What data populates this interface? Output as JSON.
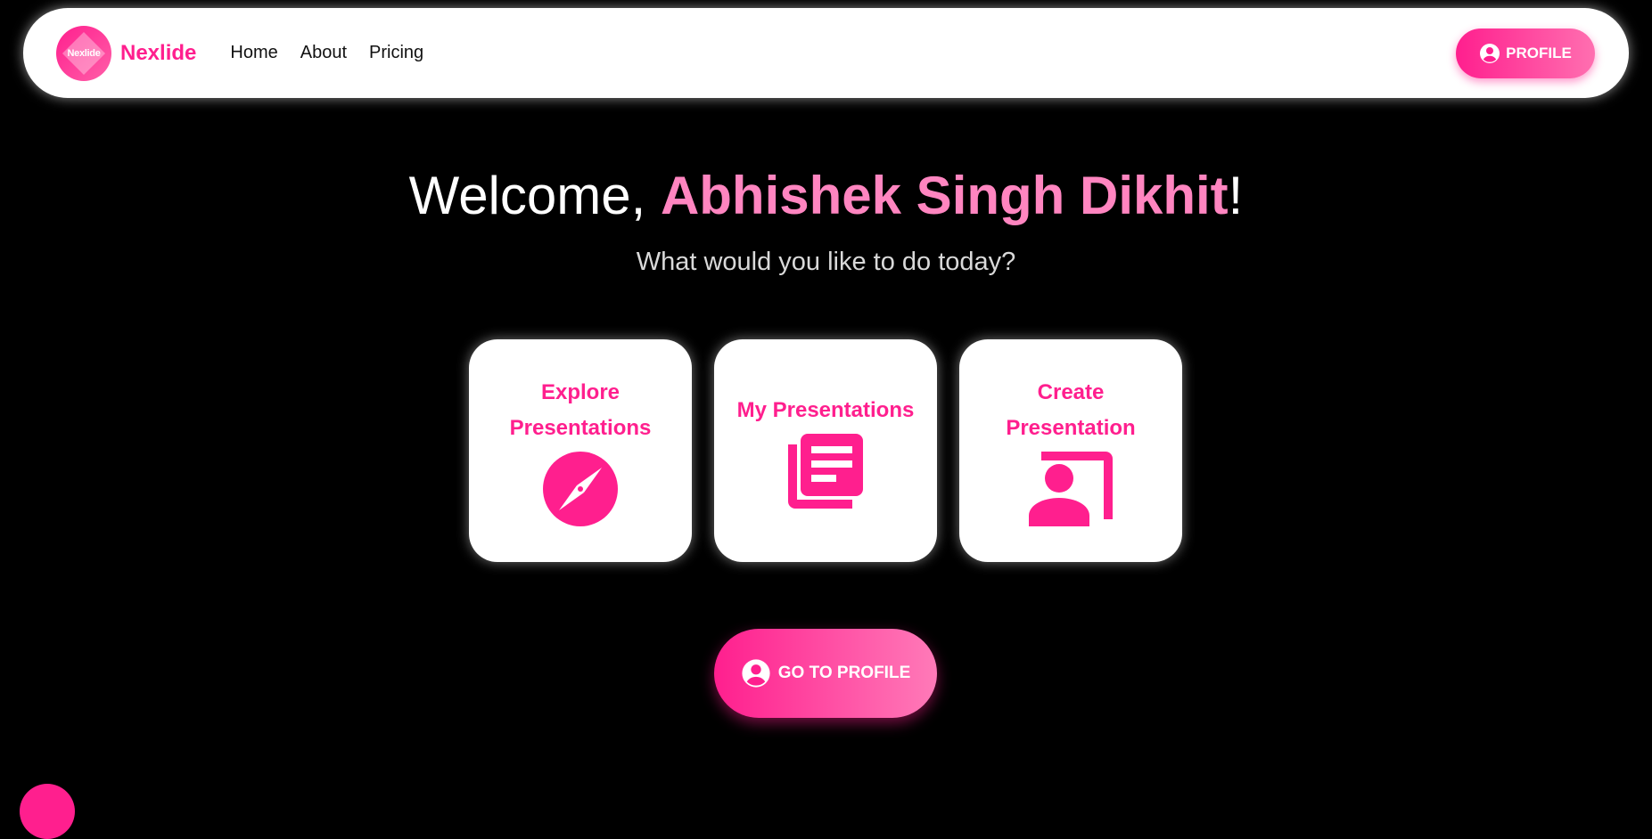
{
  "brand": {
    "logo_text": "Nexlide",
    "name": "Nexlide"
  },
  "nav": {
    "links": [
      {
        "label": "Home"
      },
      {
        "label": "About"
      },
      {
        "label": "Pricing"
      }
    ],
    "profile_button": "PROFILE"
  },
  "hero": {
    "welcome_prefix": "Welcome, ",
    "user_name": "Abhishek Singh Dikhit",
    "welcome_suffix": "!",
    "subtitle": "What would you like to do today?"
  },
  "cards": [
    {
      "title": "Explore Presentations",
      "icon": "compass-icon"
    },
    {
      "title": "My Presentations",
      "icon": "library-books-icon"
    },
    {
      "title": "Create Presentation",
      "icon": "present-to-user-icon"
    }
  ],
  "cta": {
    "label": "GO TO PROFILE",
    "icon": "user-circle-icon"
  },
  "colors": {
    "accent": "#ff1f8e",
    "accent_light": "#ff85c0",
    "background": "#000000",
    "surface": "#ffffff"
  }
}
